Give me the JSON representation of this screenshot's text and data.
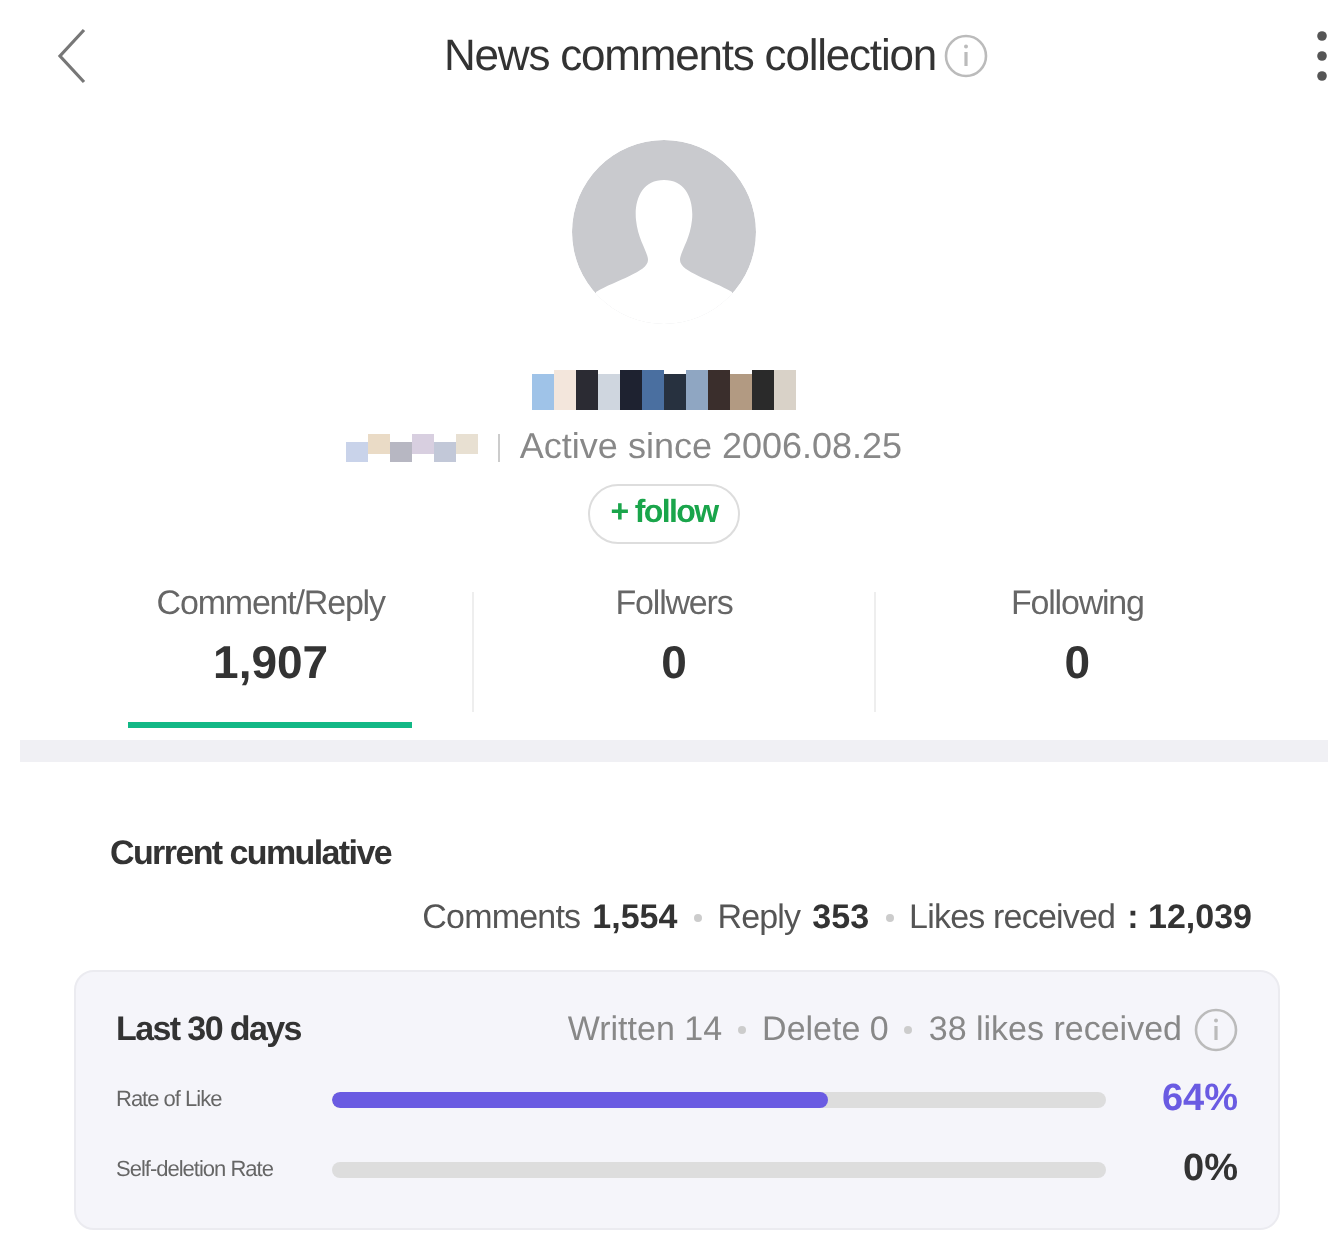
{
  "header": {
    "title": "News comments collection"
  },
  "profile": {
    "active_since": "Active since 2006.08.25",
    "follow_label": "+ follow"
  },
  "tabs": [
    {
      "label": "Comment/Reply",
      "value": "1,907",
      "selected": true
    },
    {
      "label": "Follwers",
      "value": "0",
      "selected": false
    },
    {
      "label": "Following",
      "value": "0",
      "selected": false
    }
  ],
  "cumulative": {
    "title": "Current cumulative",
    "items": [
      {
        "label": "Comments",
        "value": "1,554"
      },
      {
        "label": "Reply",
        "value": "353"
      },
      {
        "label": "Likes received",
        "value": ": 12,039"
      }
    ]
  },
  "recent": {
    "title": "Last 30 days",
    "items": [
      "Written 14",
      "Delete 0",
      "38 likes received"
    ],
    "rates": [
      {
        "label": "Rate of Like",
        "level": 0.64,
        "reading": "64%",
        "color": "#6a5be2"
      },
      {
        "label": "Self-deletion Rate",
        "level": 0,
        "reading": "0%",
        "color": "#333333"
      }
    ]
  }
}
